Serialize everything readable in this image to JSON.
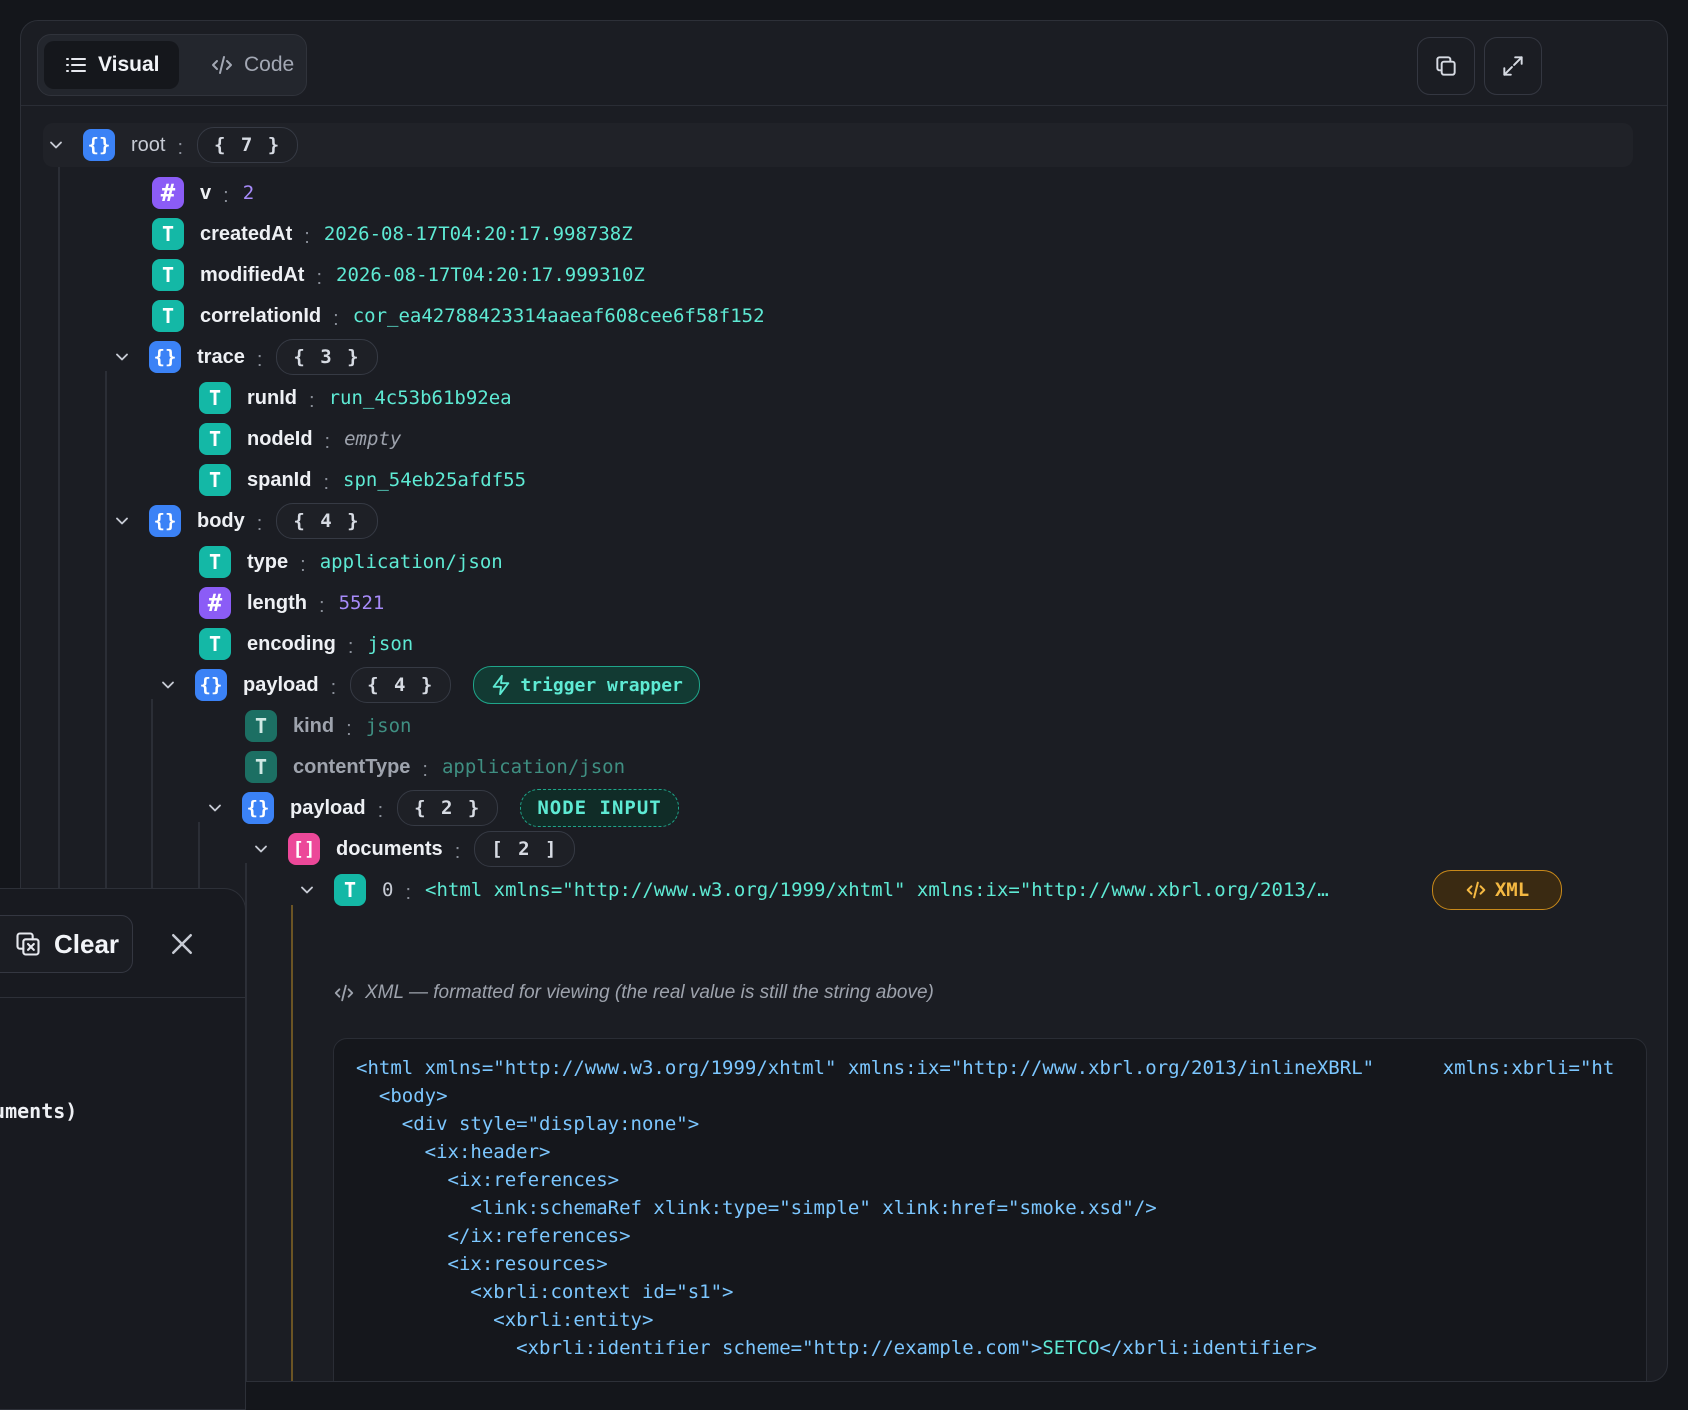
{
  "tabs": {
    "visual": "Visual",
    "code": "Code"
  },
  "tree": {
    "root": {
      "key": "root",
      "count": "{ 7 }"
    },
    "v": {
      "key": "v",
      "value": "2"
    },
    "createdAt": {
      "key": "createdAt",
      "value": "2026-08-17T04:20:17.998738Z"
    },
    "modifiedAt": {
      "key": "modifiedAt",
      "value": "2026-08-17T04:20:17.999310Z"
    },
    "correlationId": {
      "key": "correlationId",
      "value": "cor_ea42788423314aaeaf608cee6f58f152"
    },
    "trace": {
      "key": "trace",
      "count": "{ 3 }",
      "runId": {
        "key": "runId",
        "value": "run_4c53b61b92ea"
      },
      "nodeId": {
        "key": "nodeId",
        "value": "empty"
      },
      "spanId": {
        "key": "spanId",
        "value": "spn_54eb25afdf55"
      }
    },
    "body": {
      "key": "body",
      "count": "{ 4 }",
      "type": {
        "key": "type",
        "value": "application/json"
      },
      "length": {
        "key": "length",
        "value": "5521"
      },
      "encoding": {
        "key": "encoding",
        "value": "json"
      },
      "payload": {
        "key": "payload",
        "count": "{ 4 }",
        "badge": "trigger wrapper",
        "kind": {
          "key": "kind",
          "value": "json"
        },
        "contentType": {
          "key": "contentType",
          "value": "application/json"
        },
        "payload": {
          "key": "payload",
          "count": "{ 2 }",
          "badge": "NODE INPUT",
          "documents": {
            "key": "documents",
            "count": "[ 2 ]",
            "item0": {
              "key": "0",
              "value": "<html xmlns=\"http://www.w3.org/1999/xhtml\" xmlns:ix=\"http://www.xbrl.org/2013/…",
              "badge": "XML"
            }
          }
        }
      }
    }
  },
  "xml_note": "XML — formatted for viewing (the real value is still the string above)",
  "xml_lines": [
    "<html xmlns=\"http://www.w3.org/1999/xhtml\" xmlns:ix=\"http://www.xbrl.org/2013/inlineXBRL\"      xmlns:xbrli=\"ht",
    "  <body>",
    "    <div style=\"display:none\">",
    "      <ix:header>",
    "        <ix:references>",
    "          <link:schemaRef xlink:type=\"simple\" xlink:href=\"smoke.xsd\"/>",
    "        </ix:references>",
    "        <ix:resources>",
    "          <xbrli:context id=\"s1\">",
    "            <xbrli:entity>"
  ],
  "xml_last_line": {
    "open": "              <xbrli:identifier scheme=\"http://example.com\">",
    "text": "SETCO",
    "close": "</xbrli:identifier>"
  },
  "side_panel": {
    "clear_label": "Clear",
    "fragment_text": "cuments)"
  },
  "colors": {
    "object": "#3b82f6",
    "number": "#8b5cf6",
    "string": "#14b8a6",
    "array": "#ec4899",
    "accent": "#5eead4",
    "xml_badge": "#f5b942"
  },
  "icons": [
    "list-icon",
    "code-icon",
    "copy-icon",
    "expand-icon",
    "chevron-down-icon",
    "lightning-icon",
    "clear-icon",
    "close-icon"
  ]
}
